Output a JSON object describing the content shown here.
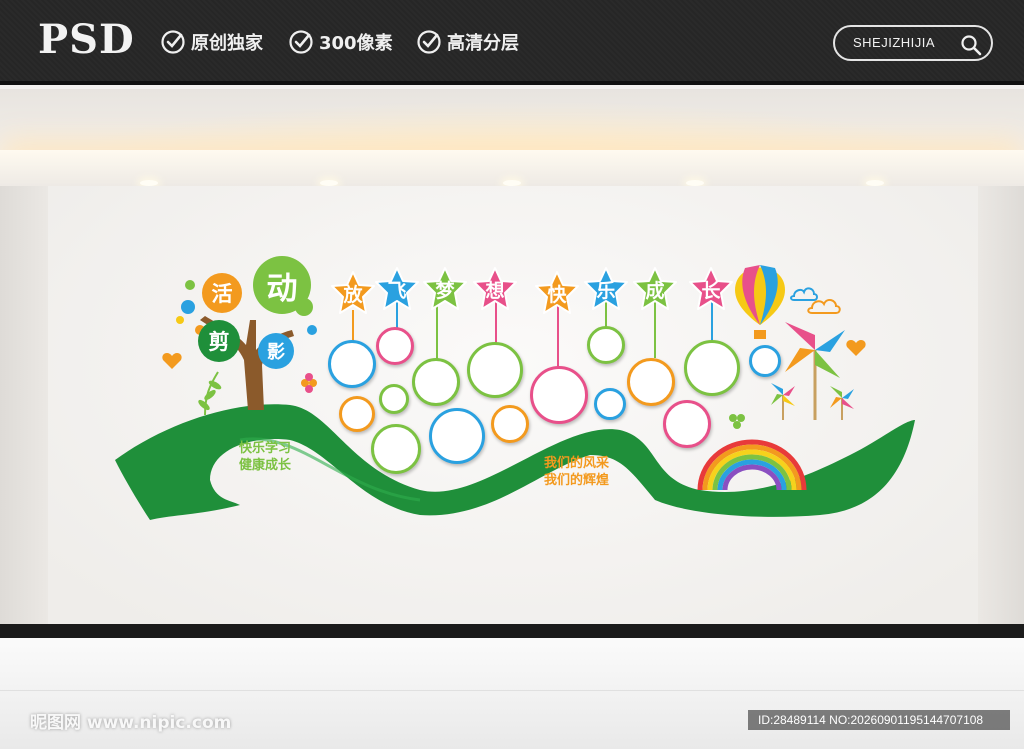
{
  "header": {
    "logo": "PSD",
    "features": [
      "原创独家",
      "300像素",
      "高清分层"
    ],
    "search_text": "SHEJIZHIJIA",
    "icons": {
      "check": "check-circle-icon",
      "search": "search-icon"
    }
  },
  "wall_art": {
    "tree_words": [
      "活",
      "动",
      "剪",
      "影"
    ],
    "star_titles": [
      "放",
      "飞",
      "梦",
      "想",
      "快",
      "乐",
      "成",
      "长"
    ],
    "slogan_left": [
      "快乐学习",
      "健康成长"
    ],
    "slogan_right": [
      "我们的风采",
      "我们的辉煌"
    ]
  },
  "colors": {
    "green": "#1f8f3a",
    "orange": "#f39a1e",
    "pink": "#e8508a",
    "blue": "#2aa1e0",
    "lime": "#7cc242",
    "topbar": "#2a2a2a"
  },
  "watermark": {
    "left": "昵图网 www.nipic.com",
    "right": "ID:28489114 NO:20260901195144707108"
  }
}
